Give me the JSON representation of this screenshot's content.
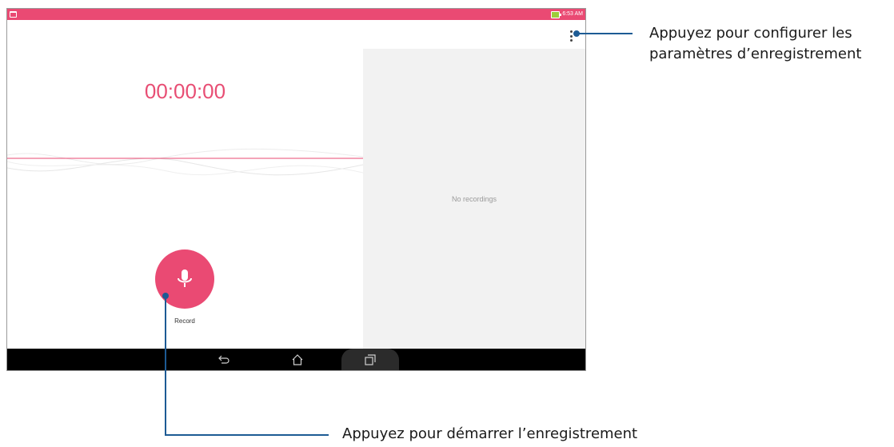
{
  "status_bar": {
    "time": "6:53 AM",
    "color": "#ea4a73",
    "icons": [
      "notification-icon",
      "battery-charging-icon"
    ]
  },
  "recorder": {
    "timer": "00:00:00",
    "record_label": "Record",
    "accent_color": "#ea4a73",
    "record_icon": "microphone-icon",
    "menu_icon": "more-vertical-icon"
  },
  "recordings_panel": {
    "empty_text": "No recordings"
  },
  "nav_bar": {
    "buttons": [
      "back-icon",
      "home-icon",
      "recent-apps-icon"
    ]
  },
  "callouts": {
    "settings": {
      "line1": "Appuyez pour configurer les",
      "line2": "paramètres d’enregistrement"
    },
    "record": {
      "text": "Appuyez pour démarrer l’enregistrement"
    },
    "color": "#1d5b94"
  }
}
